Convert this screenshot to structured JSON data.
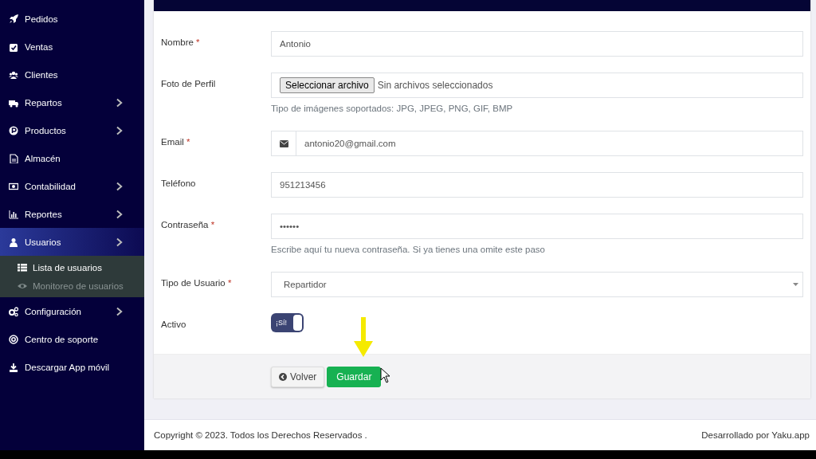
{
  "sidebar": {
    "items": [
      {
        "label": "Pedidos",
        "has_submenu": false,
        "selected": false
      },
      {
        "label": "Ventas",
        "has_submenu": false,
        "selected": false
      },
      {
        "label": "Clientes",
        "has_submenu": false,
        "selected": false
      },
      {
        "label": "Repartos",
        "has_submenu": true,
        "selected": false
      },
      {
        "label": "Productos",
        "has_submenu": true,
        "selected": false
      },
      {
        "label": "Almacén",
        "has_submenu": false,
        "selected": false
      },
      {
        "label": "Contabilidad",
        "has_submenu": true,
        "selected": false
      },
      {
        "label": "Reportes",
        "has_submenu": true,
        "selected": false
      },
      {
        "label": "Usuarios",
        "has_submenu": true,
        "selected": true,
        "children": [
          {
            "label": "Lista de usuarios",
            "selected": true
          },
          {
            "label": "Monitoreo de usuarios",
            "selected": false
          }
        ]
      },
      {
        "label": "Configuración",
        "has_submenu": true,
        "selected": false
      },
      {
        "label": "Centro de soporte",
        "has_submenu": false,
        "selected": false
      },
      {
        "label": "Descargar App móvil",
        "has_submenu": false,
        "selected": false
      }
    ]
  },
  "form": {
    "fields": [
      {
        "kind": "text",
        "label": "Nombre",
        "required_mark": "*",
        "value": "Antonio"
      },
      {
        "kind": "file",
        "label": "Foto de Perfil",
        "button": "Seleccionar archivo",
        "value": "Sin archivos seleccionados",
        "help": "Tipo de imágenes soportados: JPG, JPEG, PNG, GIF, BMP"
      },
      {
        "kind": "email",
        "label": "Email",
        "required_mark": "*",
        "value": "antonio20@gmail.com"
      },
      {
        "kind": "text",
        "label": "Teléfono",
        "value": "951213456"
      },
      {
        "kind": "password",
        "label": "Contraseña",
        "required_mark": "*",
        "value": "••••••",
        "help": "Escribe aquí tu nueva contraseña. Si ya tienes una omite este paso"
      },
      {
        "kind": "select",
        "label": "Tipo de Usuario",
        "required_mark": "*",
        "value": "Repartidor"
      },
      {
        "kind": "toggle",
        "label": "Activo",
        "on": true,
        "on_text": "¡Sí!"
      }
    ],
    "buttons": [
      {
        "kind": "back",
        "label": "Volver"
      },
      {
        "kind": "primary",
        "label": "Guardar"
      }
    ]
  },
  "footer": {
    "copyright": "Copyright © 2023. Todos los Derechos Reservados .",
    "credit": "Desarrollado por Yaku.app"
  }
}
